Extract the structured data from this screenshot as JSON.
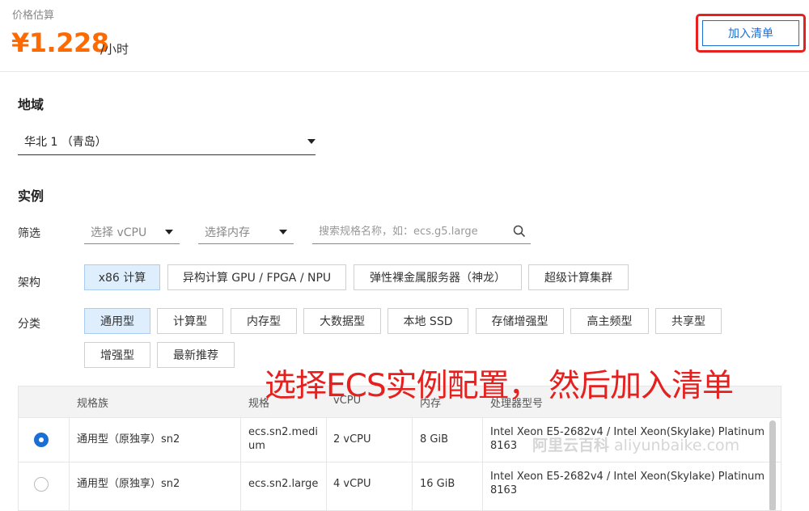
{
  "header": {
    "price_label": "价格估算",
    "price": "¥1.228",
    "unit": "/小时",
    "add_button": "加入清单"
  },
  "region": {
    "title": "地域",
    "selected": "华北 1 （青岛）"
  },
  "instance": {
    "title": "实例",
    "filter_label": "筛选",
    "vcpu_placeholder": "选择 vCPU",
    "memory_placeholder": "选择内存",
    "search_placeholder": "搜索规格名称，如：ecs.g5.large",
    "arch_label": "架构",
    "arch_options": [
      "x86 计算",
      "异构计算 GPU / FPGA / NPU",
      "弹性裸金属服务器（神龙）",
      "超级计算集群"
    ],
    "category_label": "分类",
    "categories": [
      "通用型",
      "计算型",
      "内存型",
      "大数据型",
      "本地 SSD",
      "存储增强型",
      "高主频型",
      "共享型",
      "增强型",
      "最新推荐"
    ]
  },
  "annotation": "选择ECS实例配置， 然后加入清单",
  "table": {
    "headers": [
      "规格族",
      "规格",
      "vCPU",
      "内存",
      "处理器型号"
    ],
    "rows": [
      {
        "selected": true,
        "family": "通用型（原独享）sn2",
        "spec": "ecs.sn2.medium",
        "vcpu": "2 vCPU",
        "memory": "8 GiB",
        "cpu_model": "Intel Xeon E5-2682v4 / Intel Xeon(Skylake) Platinum 8163"
      },
      {
        "selected": false,
        "family": "通用型（原独享）sn2",
        "spec": "ecs.sn2.large",
        "vcpu": "4 vCPU",
        "memory": "16 GiB",
        "cpu_model": "Intel Xeon E5-2682v4 / Intel Xeon(Skylake) Platinum 8163"
      }
    ]
  },
  "watermark": {
    "cn": "阿里云百科",
    "en": "aliyunbaike.com"
  },
  "colors": {
    "price": "#ff6a00",
    "primary": "#1b6fd4",
    "highlight": "#e5201e",
    "chip_active": "#deeefc"
  }
}
